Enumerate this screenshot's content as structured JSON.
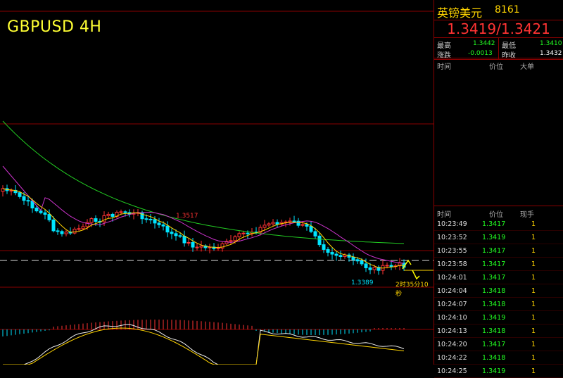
{
  "chart": {
    "title": "GBPUSD 4H",
    "high_label": "1.3517",
    "low_label": "1.3389",
    "countdown": "2时35分10秒"
  },
  "quote": {
    "name": "英镑美元",
    "code": "8161",
    "price": "1.3419/1.3421",
    "high_label": "最高",
    "high": "1.3442",
    "low_label": "最低",
    "low": "1.3410",
    "change_label": "涨跌",
    "change": "-0.0013",
    "prev_close_label": "昨收",
    "prev_close": "1.3432"
  },
  "big_orders": {
    "col_time": "时间",
    "col_price": "价位",
    "col_big": "大单"
  },
  "ticks": {
    "col_time": "时间",
    "col_price": "价位",
    "col_vol": "现手",
    "rows": [
      {
        "time": "10:23:49",
        "price": "1.3417",
        "vol": "1"
      },
      {
        "time": "10:23:52",
        "price": "1.3419",
        "vol": "1"
      },
      {
        "time": "10:23:55",
        "price": "1.3417",
        "vol": "1"
      },
      {
        "time": "10:23:58",
        "price": "1.3417",
        "vol": "1"
      },
      {
        "time": "10:24:01",
        "price": "1.3417",
        "vol": "1"
      },
      {
        "time": "10:24:04",
        "price": "1.3418",
        "vol": "1"
      },
      {
        "time": "10:24:07",
        "price": "1.3418",
        "vol": "1"
      },
      {
        "time": "10:24:10",
        "price": "1.3419",
        "vol": "1"
      },
      {
        "time": "10:24:13",
        "price": "1.3418",
        "vol": "1"
      },
      {
        "time": "10:24:20",
        "price": "1.3417",
        "vol": "1"
      },
      {
        "time": "10:24:22",
        "price": "1.3418",
        "vol": "1"
      },
      {
        "time": "10:24:25",
        "price": "1.3419",
        "vol": "1"
      }
    ]
  },
  "colors": {
    "up": "#ff3333",
    "down": "#00e5ff",
    "ma_long": "#22cc22",
    "ma_mid": "#cc33cc",
    "ma_short": "#ffd400",
    "grid": "#8a0000"
  }
}
